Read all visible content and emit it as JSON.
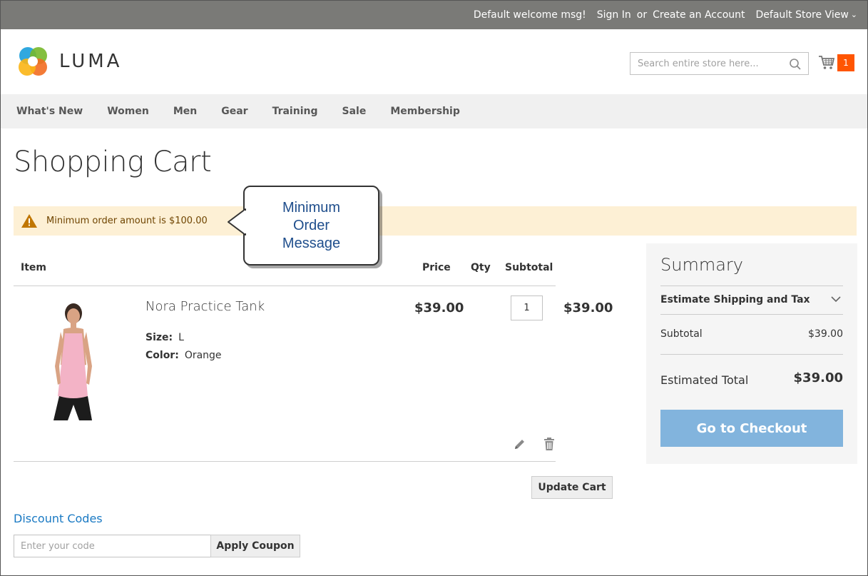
{
  "top_panel": {
    "welcome": "Default welcome msg!",
    "sign_in": "Sign In",
    "or": "or",
    "create_account": "Create an Account",
    "store_view": "Default Store View"
  },
  "header": {
    "brand": "LUMA",
    "search_placeholder": "Search entire store here...",
    "cart_count": "1",
    "accent_color": "#ff5501"
  },
  "nav": {
    "items": [
      "What's New",
      "Women",
      "Men",
      "Gear",
      "Training",
      "Sale",
      "Membership"
    ]
  },
  "page_title": "Shopping Cart",
  "message": {
    "text": "Minimum order amount is $100.00",
    "icon": "warning-icon"
  },
  "callout": {
    "line1": "Minimum",
    "line2": "Order",
    "line3": "Message"
  },
  "cart_table": {
    "headers": {
      "item": "Item",
      "price": "Price",
      "qty": "Qty",
      "subtotal": "Subtotal"
    },
    "rows": [
      {
        "name": "Nora Practice Tank",
        "options": [
          {
            "label": "Size:",
            "value": "L"
          },
          {
            "label": "Color:",
            "value": "Orange"
          }
        ],
        "price": "$39.00",
        "qty": "1",
        "subtotal": "$39.00"
      }
    ]
  },
  "actions": {
    "update_cart": "Update Cart"
  },
  "discount": {
    "title": "Discount Codes",
    "placeholder": "Enter your code",
    "apply": "Apply Coupon"
  },
  "summary": {
    "title": "Summary",
    "estimate_shipping": "Estimate Shipping and Tax",
    "subtotal_label": "Subtotal",
    "subtotal_value": "$39.00",
    "total_label": "Estimated Total",
    "total_value": "$39.00",
    "checkout": "Go to Checkout",
    "checkout_color": "#82b4dd"
  }
}
